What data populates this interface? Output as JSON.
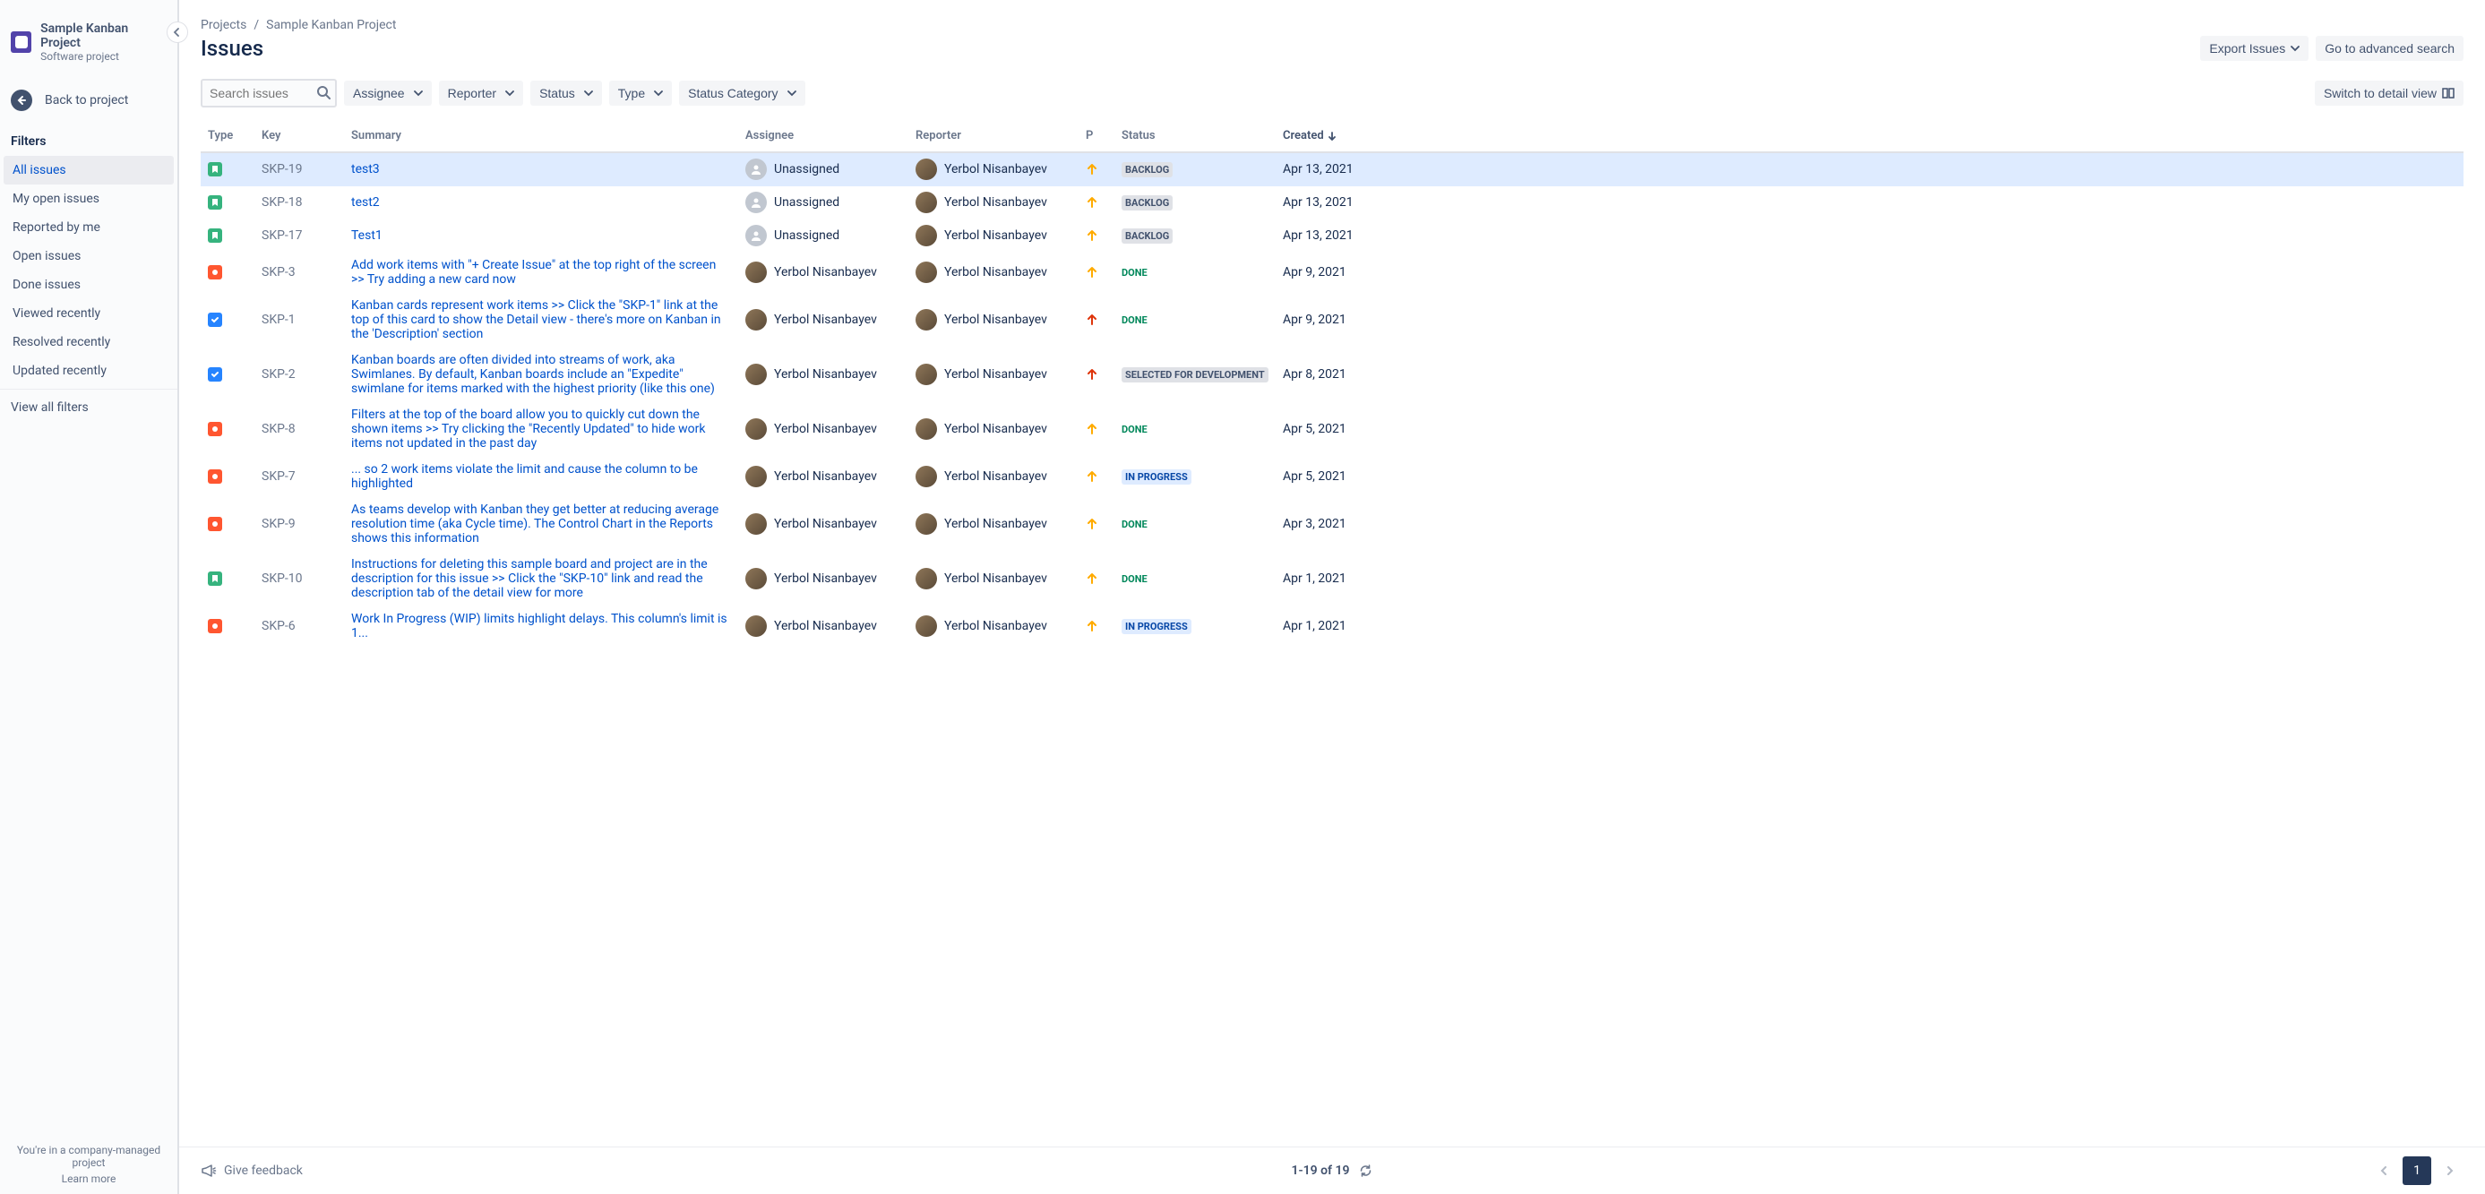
{
  "project": {
    "name": "Sample Kanban Project",
    "subtitle": "Software project"
  },
  "back": "Back to project",
  "filters": {
    "heading": "Filters",
    "items": [
      "All issues",
      "My open issues",
      "Reported by me",
      "Open issues",
      "Done issues",
      "Viewed recently",
      "Resolved recently",
      "Updated recently"
    ],
    "view_all": "View all filters",
    "active_index": 0
  },
  "sidebar_footer": {
    "line1": "You're in a company-managed project",
    "link": "Learn more"
  },
  "breadcrumb": {
    "root": "Projects",
    "project": "Sample Kanban Project"
  },
  "page_title": "Issues",
  "actions": {
    "export": "Export Issues",
    "advanced": "Go to advanced search",
    "switch": "Switch to detail view"
  },
  "search_placeholder": "Search issues",
  "filter_buttons": [
    "Assignee",
    "Reporter",
    "Status",
    "Type",
    "Status Category"
  ],
  "columns": {
    "type": "Type",
    "key": "Key",
    "summary": "Summary",
    "assignee": "Assignee",
    "reporter": "Reporter",
    "p": "P",
    "status": "Status",
    "created": "Created"
  },
  "rows": [
    {
      "type": "story",
      "key": "SKP-19",
      "summary": "test3",
      "assignee": "Unassigned",
      "reporter": "Yerbol Nisanbayev",
      "priority": "medium",
      "status": "BACKLOG",
      "status_kind": "default",
      "created": "Apr 13, 2021",
      "selected": true
    },
    {
      "type": "story",
      "key": "SKP-18",
      "summary": "test2",
      "assignee": "Unassigned",
      "reporter": "Yerbol Nisanbayev",
      "priority": "medium",
      "status": "BACKLOG",
      "status_kind": "default",
      "created": "Apr 13, 2021"
    },
    {
      "type": "story",
      "key": "SKP-17",
      "summary": "Test1",
      "assignee": "Unassigned",
      "reporter": "Yerbol Nisanbayev",
      "priority": "medium",
      "status": "BACKLOG",
      "status_kind": "default",
      "created": "Apr 13, 2021"
    },
    {
      "type": "bug",
      "key": "SKP-3",
      "summary": "Add work items with \"+ Create Issue\" at the top right of the screen >> Try adding a new card now",
      "assignee": "Yerbol Nisanbayev",
      "reporter": "Yerbol Nisanbayev",
      "priority": "medium",
      "status": "DONE",
      "status_kind": "done",
      "created": "Apr 9, 2021"
    },
    {
      "type": "task",
      "key": "SKP-1",
      "summary": "Kanban cards represent work items >> Click the \"SKP-1\" link at the top of this card to show the Detail view - there's more on Kanban in the 'Description' section",
      "assignee": "Yerbol Nisanbayev",
      "reporter": "Yerbol Nisanbayev",
      "priority": "highest",
      "status": "DONE",
      "status_kind": "done",
      "created": "Apr 9, 2021"
    },
    {
      "type": "task",
      "key": "SKP-2",
      "summary": "Kanban boards are often divided into streams of work, aka Swimlanes. By default, Kanban boards include an \"Expedite\" swimlane for items marked with the highest priority (like this one)",
      "assignee": "Yerbol Nisanbayev",
      "reporter": "Yerbol Nisanbayev",
      "priority": "highest",
      "status": "SELECTED FOR DEVELOPMENT",
      "status_kind": "default",
      "created": "Apr 8, 2021"
    },
    {
      "type": "bug",
      "key": "SKP-8",
      "summary": "Filters at the top of the board allow you to quickly cut down the shown items >> Try clicking the \"Recently Updated\" to hide work items not updated in the past day",
      "assignee": "Yerbol Nisanbayev",
      "reporter": "Yerbol Nisanbayev",
      "priority": "medium",
      "status": "DONE",
      "status_kind": "done",
      "created": "Apr 5, 2021"
    },
    {
      "type": "bug",
      "key": "SKP-7",
      "summary": "... so 2 work items violate the limit and cause the column to be highlighted",
      "assignee": "Yerbol Nisanbayev",
      "reporter": "Yerbol Nisanbayev",
      "priority": "medium",
      "status": "IN PROGRESS",
      "status_kind": "progress",
      "created": "Apr 5, 2021"
    },
    {
      "type": "bug",
      "key": "SKP-9",
      "summary": "As teams develop with Kanban they get better at reducing average resolution time (aka Cycle time). The Control Chart in the Reports shows this information",
      "assignee": "Yerbol Nisanbayev",
      "reporter": "Yerbol Nisanbayev",
      "priority": "medium",
      "status": "DONE",
      "status_kind": "done",
      "created": "Apr 3, 2021"
    },
    {
      "type": "story",
      "key": "SKP-10",
      "summary": "Instructions for deleting this sample board and project are in the description for this issue >> Click the \"SKP-10\" link and read the description tab of the detail view for more",
      "assignee": "Yerbol Nisanbayev",
      "reporter": "Yerbol Nisanbayev",
      "priority": "medium",
      "status": "DONE",
      "status_kind": "done",
      "created": "Apr 1, 2021"
    },
    {
      "type": "bug",
      "key": "SKP-6",
      "summary": "Work In Progress (WIP) limits highlight delays. This column's limit is 1...",
      "assignee": "Yerbol Nisanbayev",
      "reporter": "Yerbol Nisanbayev",
      "priority": "medium",
      "status": "IN PROGRESS",
      "status_kind": "progress",
      "created": "Apr 1, 2021"
    }
  ],
  "footer": {
    "feedback": "Give feedback",
    "range": "1-19 of 19",
    "page": "1"
  }
}
